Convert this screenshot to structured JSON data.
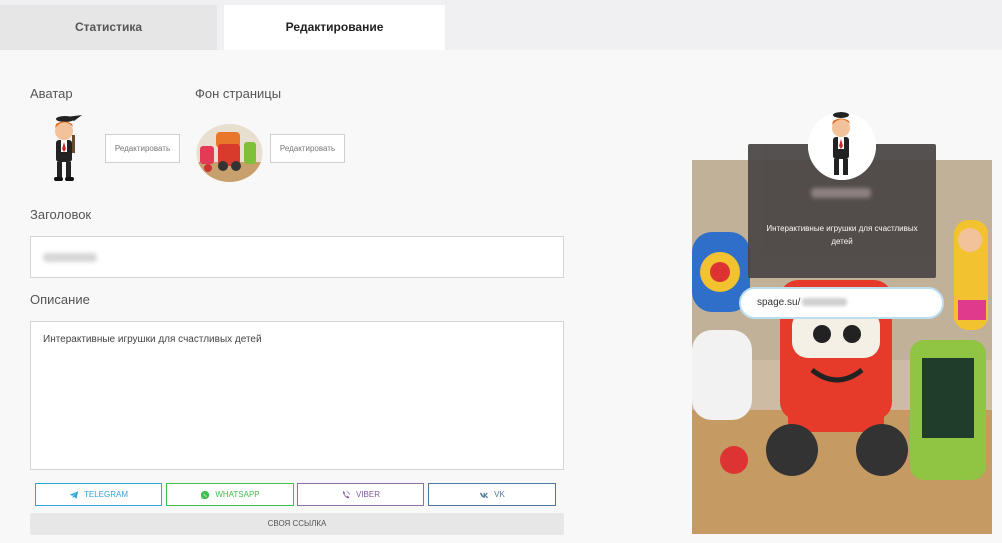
{
  "tabs": {
    "stats": "Статистика",
    "edit": "Редактирование"
  },
  "labels": {
    "avatar": "Аватар",
    "background": "Фон страницы",
    "title": "Заголовок",
    "description": "Описание"
  },
  "buttons": {
    "edit_avatar": "Редактировать",
    "edit_background": "Редактировать",
    "own_link": "СВОЯ ССЫЛКА"
  },
  "form": {
    "description_value": "Интерактивные игрушки для счастливых детей"
  },
  "social": [
    {
      "label": "TELEGRAM",
      "icon": "telegram-icon",
      "color": "#2ea6db"
    },
    {
      "label": "WHATSAPP",
      "icon": "whatsapp-icon",
      "color": "#3fbf4f"
    },
    {
      "label": "VIBER",
      "icon": "viber-icon",
      "color": "#7f5b9c"
    },
    {
      "label": "VK",
      "icon": "vk-icon",
      "color": "#4f7a9c"
    }
  ],
  "preview": {
    "description": "Интерактивные игрушки для счастливых детей",
    "link_prefix": "spage.su/"
  }
}
